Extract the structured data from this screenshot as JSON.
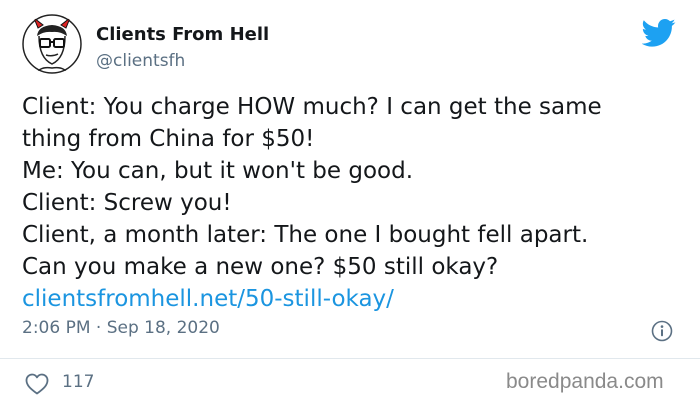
{
  "author": {
    "display_name": "Clients From Hell",
    "handle": "@clientsfh",
    "avatar_icon": "devil-face-avatar-icon"
  },
  "platform_icon": "twitter-bird-icon",
  "tweet": {
    "lines": [
      "Client: You charge HOW much? I can get the same",
      "thing from China for $50!",
      "Me: You can, but it won't be good.",
      "Client: Screw you!",
      "Client, a month later: The one I bought fell apart.",
      "Can you make a new one? $50 still okay?"
    ],
    "link_text": "clientsfromhell.net/50-still-okay/"
  },
  "timestamp": "2:06 PM · Sep 18, 2020",
  "info_icon": "info-icon",
  "actions": {
    "like_icon": "heart-icon",
    "like_count": "117"
  },
  "watermark": "boredpanda.com",
  "colors": {
    "link": "#1b95e0",
    "twitter_blue": "#1da1f2",
    "secondary_text": "#5b7083",
    "divider": "#e1e8ed"
  }
}
